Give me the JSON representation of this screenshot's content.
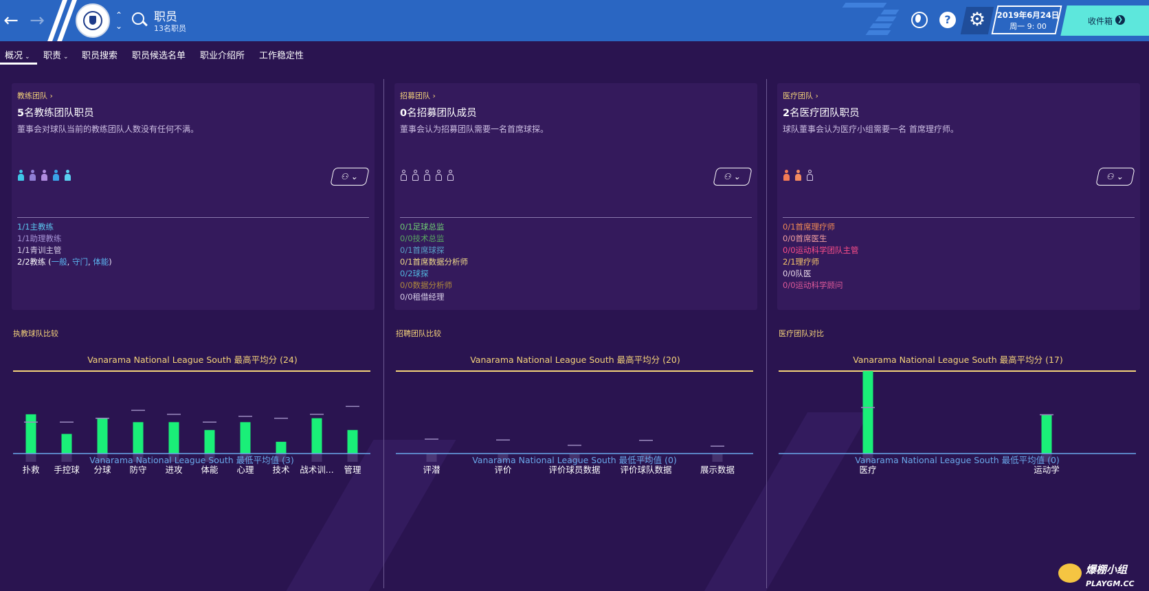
{
  "header": {
    "title": "职员",
    "subtitle": "13名职员",
    "date_line1": "2019年6月24日",
    "date_line2": "周一 9: 00",
    "inbox_label": "收件箱"
  },
  "nav": {
    "tabs": [
      {
        "label": "概况",
        "dropdown": true
      },
      {
        "label": "职责",
        "dropdown": true
      },
      {
        "label": "职员搜索"
      },
      {
        "label": "职员候选名单"
      },
      {
        "label": "职业介绍所"
      },
      {
        "label": "工作稳定性"
      }
    ]
  },
  "panels": [
    {
      "crumb": "教练团队",
      "count": "5",
      "heading_rest": "名教练团队职员",
      "desc": "董事会对球队当前的教练团队人数没有任何不满。",
      "people_colors": [
        "#3fc7e8",
        "#8f7fd6",
        "#b08be0",
        "#3aa3e8",
        "#5ad0f0"
      ],
      "roles": [
        {
          "text": "1/1主教练",
          "color": "#5bc8f0"
        },
        {
          "text": "1/1助理教练",
          "color": "#a694d6"
        },
        {
          "text": "1/1青训主管",
          "color": "#d8cfe8"
        },
        {
          "text": "2/2教练 (",
          "color": "#ffffff"
        }
      ],
      "coach_types": [
        "一般",
        "守门",
        "体能"
      ]
    },
    {
      "crumb": "招募团队",
      "count": "0",
      "heading_rest": "名招募团队成员",
      "desc": "董事会认为招募团队需要一名首席球探。",
      "empty_people": 5,
      "roles": [
        {
          "text": "0/1足球总监",
          "color": "#6fcf73"
        },
        {
          "text": "0/0技术总监",
          "color": "#58a860"
        },
        {
          "text": "0/1首席球探",
          "color": "#5aa3c8"
        },
        {
          "text": "0/1首席数据分析师",
          "color": "#f2dc8a"
        },
        {
          "text": "0/2球探",
          "color": "#52b8e0"
        },
        {
          "text": "0/0数据分析师",
          "color": "#b08a3c"
        },
        {
          "text": "0/0租借经理",
          "color": "#d8cfe8"
        }
      ]
    },
    {
      "crumb": "医疗团队",
      "count": "2",
      "heading_rest": "名医疗团队职员",
      "desc": "球队董事会认为医疗小组需要一名 首席理疗师。",
      "people_colors": [
        "#f27a55",
        "#f28a60"
      ],
      "empty_people": 1,
      "roles": [
        {
          "text": "0/1首席理疗师",
          "color": "#f08a55"
        },
        {
          "text": "0/0首席医生",
          "color": "#f4a0a0"
        },
        {
          "text": "0/0运动科学团队主管",
          "color": "#ff4f8a"
        },
        {
          "text": "2/1理疗师",
          "color": "#f7c56a"
        },
        {
          "text": "0/0队医",
          "color": "#e8d8e8"
        },
        {
          "text": "0/0运动科学顾问",
          "color": "#e05a9a"
        }
      ]
    }
  ],
  "chart_data": [
    {
      "type": "bar",
      "title": "执教球队比较",
      "max_label": "Vanarama National League South 最高平均分 (24)",
      "min_label": "Vanarama National League South 最低平均值 (3)",
      "ylim": [
        3,
        24
      ],
      "categories": [
        "扑救",
        "手控球",
        "分球",
        "防守",
        "进攻",
        "体能",
        "心理",
        "技术",
        "战术训...",
        "管理"
      ],
      "series": [
        {
          "values": [
            13,
            8,
            12,
            11,
            11,
            9,
            11,
            6,
            12,
            9
          ]
        }
      ],
      "league_average": [
        11,
        11,
        12,
        14,
        13,
        11,
        12.5,
        12,
        13,
        15
      ]
    },
    {
      "type": "bar",
      "title": "招聘团队比较",
      "max_label": "Vanarama National League South 最高平均分 (20)",
      "min_label": "Vanarama National League South 最低平均值 (0)",
      "ylim": [
        0,
        20
      ],
      "categories": [
        "评潜",
        "评价",
        "评价球员数据",
        "评价球队数据",
        "展示数据"
      ],
      "series": [
        {
          "values": [
            0,
            0,
            0,
            0,
            0
          ]
        }
      ],
      "league_average": [
        3.5,
        3.3,
        2,
        3.2,
        1.8
      ]
    },
    {
      "type": "bar",
      "title": "医疗团队对比",
      "max_label": "Vanarama National League South 最高平均分 (17)",
      "min_label": "Vanarama National League South 最低平均值 (0)",
      "ylim": [
        0,
        17
      ],
      "categories": [
        "医疗",
        "运动学"
      ],
      "series": [
        {
          "values": [
            17,
            8
          ]
        }
      ],
      "league_average": [
        9.5,
        8
      ]
    }
  ],
  "colors": {
    "bar": "#1aef78",
    "max_line": "#f6d47a",
    "min_line": "#6aa8ea",
    "bg": "#2a1450",
    "topbar": "#2a66c2"
  }
}
